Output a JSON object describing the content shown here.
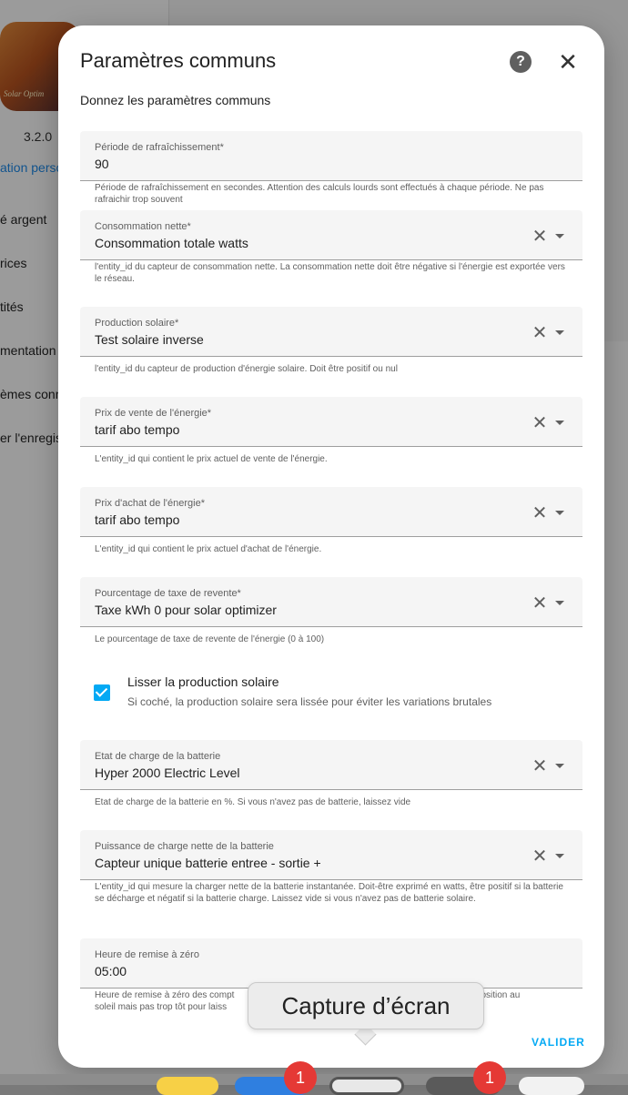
{
  "background": {
    "logo_text": "Solar Optim",
    "version": "3.2.0",
    "side_link": "ation perso",
    "side_items": [
      "é argent",
      "rices",
      "tités",
      "mentation",
      "èmes conn",
      "er l'enregist"
    ]
  },
  "dialog": {
    "title": "Paramètres communs",
    "subtitle": "Donnez les paramètres communs",
    "help_icon": "question-circle-icon",
    "close_icon": "close-icon",
    "fields": [
      {
        "label": "Période de rafraîchissement*",
        "value": "90",
        "helper": "Période de rafraîchissement en secondes. Attention des calculs lourds sont effectués à chaque période. Ne pas rafraichir trop souvent"
      },
      {
        "label": "Consommation nette*",
        "value": "Consommation totale watts",
        "helper": "l'entity_id du capteur de consommation nette. La consommation nette doit être négative si l'énergie est exportée vers le réseau."
      },
      {
        "label": "Production solaire*",
        "value": "Test solaire inverse",
        "helper": "l'entity_id du capteur de production d'énergie solaire. Doit être positif ou nul"
      },
      {
        "label": "Prix de vente de l'énergie*",
        "value": "tarif abo tempo",
        "helper": "L'entity_id qui contient le prix actuel de vente de l'énergie."
      },
      {
        "label": "Prix d'achat de l'énergie*",
        "value": "tarif abo tempo",
        "helper": "L'entity_id qui contient le prix actuel d'achat de l'énergie."
      },
      {
        "label": "Pourcentage de taxe de revente*",
        "value": "Taxe kWh 0 pour solar optimizer",
        "helper": "Le pourcentage de taxe de revente de l'énergie (0 à 100)"
      },
      {
        "label": "Etat de charge de la batterie",
        "value": "Hyper 2000 Electric Level",
        "helper": "Etat de charge de la batterie en %. Si vous n'avez pas de batterie, laissez vide"
      },
      {
        "label": "Puissance de charge nette de la batterie",
        "value": "Capteur unique batterie entree - sortie +",
        "helper": "L'entity_id qui mesure la charger nette de la batterie instantanée. Doit-être exprimé en watts, être positif si la batterie se décharge et négatif si la batterie charge. Laissez vide si vous n'avez pas de batterie solaire."
      },
      {
        "label": "Heure de remise à zéro",
        "value": "05:00",
        "helper_left": "Heure de remise à zéro des compt",
        "helper_right": "e exposition au",
        "helper_left2": "soleil mais pas trop tôt pour laiss"
      }
    ],
    "checkbox": {
      "label": "Lisser la production solaire",
      "description": "Si coché, la production solaire sera lissée pour éviter les variations brutales",
      "checked": true
    },
    "submit_label": "VALIDER"
  },
  "tooltip": {
    "text": "Capture d’écran"
  },
  "dock": {
    "badges": [
      "1",
      "1"
    ]
  },
  "colors": {
    "accent": "#03a9f4",
    "badge": "#e53935"
  }
}
